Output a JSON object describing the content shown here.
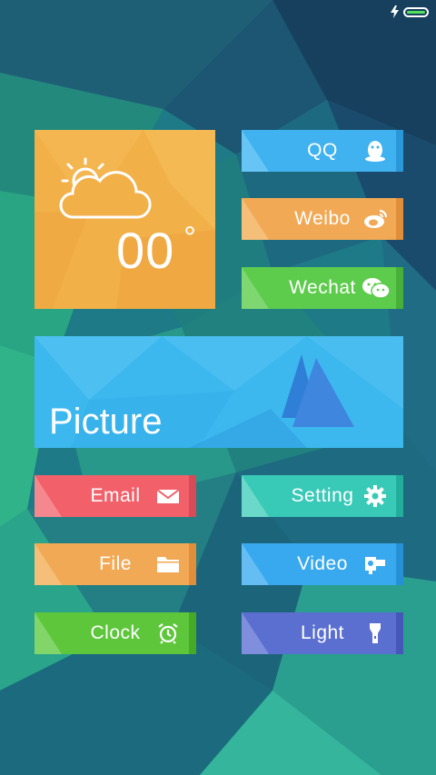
{
  "status_bar": {
    "battery_icon": "battery-icon",
    "charging_icon": "charging-bolt-icon"
  },
  "weather": {
    "icon": "partly-cloudy-icon",
    "temperature": "00",
    "degree_symbol": "°"
  },
  "right_buttons": [
    {
      "label": "QQ",
      "icon": "qq-penguin-icon",
      "color": "#3fb2ef"
    },
    {
      "label": "Weibo",
      "icon": "weibo-icon",
      "color": "#f2a955"
    },
    {
      "label": "Wechat",
      "icon": "wechat-icon",
      "color": "#5dcb4c"
    }
  ],
  "picture": {
    "label": "Picture",
    "icon": "mountain-icon",
    "color": "#3db8ef"
  },
  "grid_buttons": [
    {
      "label": "Email",
      "icon": "envelope-icon",
      "color": "#f2606a"
    },
    {
      "label": "Setting",
      "icon": "gear-icon",
      "color": "#39c9b7"
    },
    {
      "label": "File",
      "icon": "folder-icon",
      "color": "#f2a955"
    },
    {
      "label": "Video",
      "icon": "video-camera-icon",
      "color": "#39a9ef"
    },
    {
      "label": "Clock",
      "icon": "alarm-clock-icon",
      "color": "#5dc63b"
    },
    {
      "label": "Light",
      "icon": "flashlight-icon",
      "color": "#5b6fd0"
    }
  ]
}
